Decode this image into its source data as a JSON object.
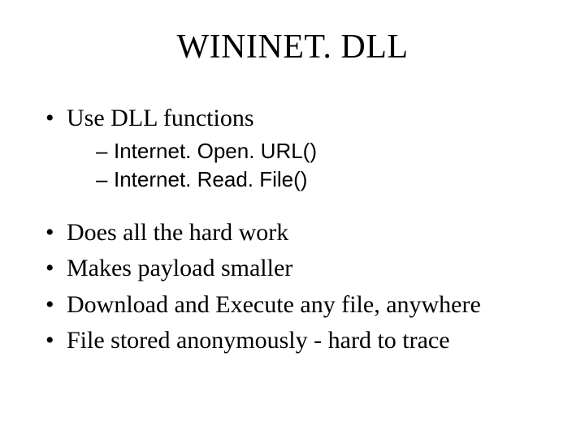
{
  "title": "WININET. DLL",
  "bullets": {
    "b0": "Use DLL functions",
    "sub0": "Internet. Open. URL()",
    "sub1": "Internet. Read. File()",
    "b1": "Does all the hard work",
    "b2": "Makes payload smaller",
    "b3": "Download and Execute any file, anywhere",
    "b4": "File stored anonymously - hard to trace"
  }
}
